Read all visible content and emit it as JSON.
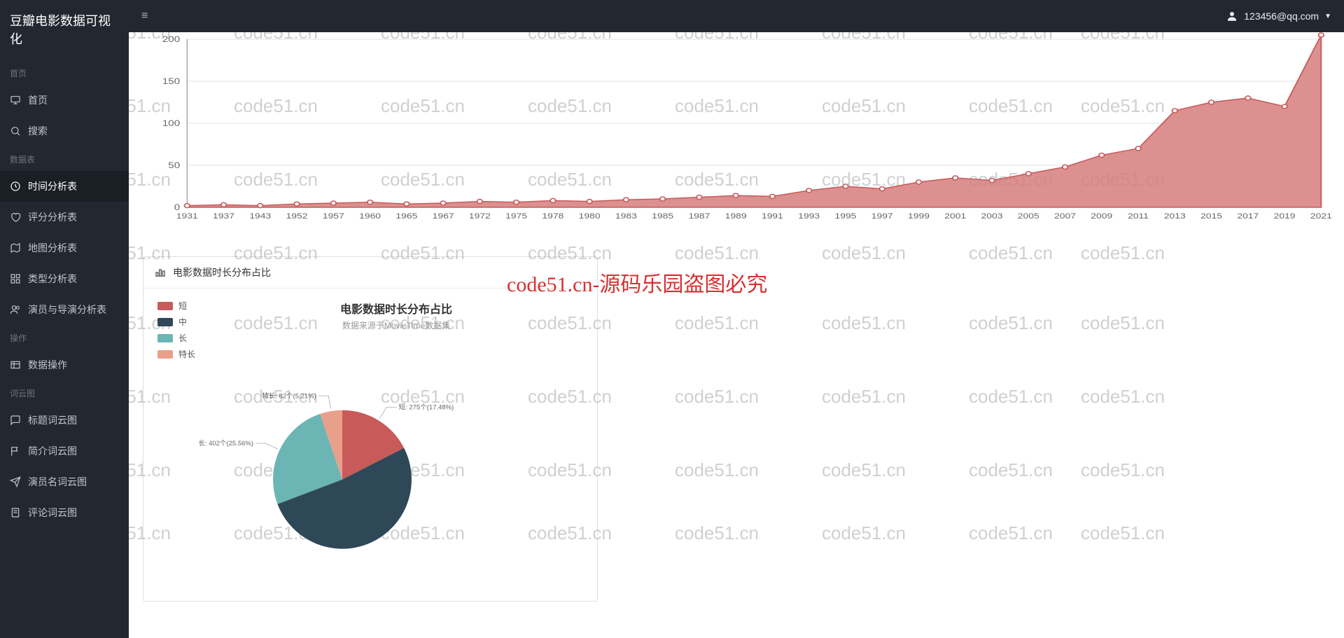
{
  "brand": "豆瓣电影数据可视化",
  "user": {
    "email": "123456@qq.com"
  },
  "sidebar": {
    "sections": [
      {
        "label": "首页",
        "items": [
          {
            "icon": "monitor",
            "label": "首页",
            "active": false
          },
          {
            "icon": "search",
            "label": "搜索",
            "active": false
          }
        ]
      },
      {
        "label": "数据表",
        "items": [
          {
            "icon": "clock",
            "label": "时间分析表",
            "active": true
          },
          {
            "icon": "heart",
            "label": "评分分析表",
            "active": false
          },
          {
            "icon": "map",
            "label": "地图分析表",
            "active": false
          },
          {
            "icon": "grid",
            "label": "类型分析表",
            "active": false
          },
          {
            "icon": "users",
            "label": "演员与导演分析表",
            "active": false
          }
        ]
      },
      {
        "label": "操作",
        "items": [
          {
            "icon": "table",
            "label": "数据操作",
            "active": false
          }
        ]
      },
      {
        "label": "词云图",
        "items": [
          {
            "icon": "comment",
            "label": "标题词云图",
            "active": false
          },
          {
            "icon": "flag",
            "label": "简介词云图",
            "active": false
          },
          {
            "icon": "send",
            "label": "演员名词云图",
            "active": false
          },
          {
            "icon": "doc",
            "label": "评论词云图",
            "active": false
          }
        ]
      }
    ]
  },
  "pieCard": {
    "header": "电影数据时长分布占比",
    "title": "电影数据时长分布占比",
    "subtitle": "数据来源于MovieTime数据集"
  },
  "watermark_text": "code51.cn",
  "watermark_red": "code51.cn-源码乐园盗图必究",
  "chart_data": [
    {
      "type": "area",
      "title": "",
      "ylabel": "",
      "ylim": [
        0,
        200
      ],
      "yticks": [
        0,
        50,
        100,
        150,
        200
      ],
      "categories": [
        "1931",
        "1937",
        "1943",
        "1952",
        "1957",
        "1960",
        "1965",
        "1967",
        "1972",
        "1975",
        "1978",
        "1980",
        "1983",
        "1985",
        "1987",
        "1989",
        "1991",
        "1993",
        "1995",
        "1997",
        "1999",
        "2001",
        "2003",
        "2005",
        "2007",
        "2009",
        "2011",
        "2013",
        "2015",
        "2017",
        "2019",
        "2021"
      ],
      "values": [
        2,
        3,
        2,
        4,
        5,
        6,
        4,
        5,
        7,
        6,
        8,
        7,
        9,
        10,
        12,
        14,
        13,
        20,
        25,
        22,
        30,
        35,
        32,
        40,
        48,
        62,
        70,
        115,
        125,
        130,
        120,
        205
      ]
    },
    {
      "type": "pie",
      "title": "电影数据时长分布占比",
      "subtitle": "数据来源于MovieTime数据集",
      "series": [
        {
          "name": "短",
          "value": 275,
          "pct": 17.48,
          "color": "#c85a5a",
          "label": "短: 275个(17.48%)"
        },
        {
          "name": "中",
          "value": 814,
          "pct": 51.75,
          "color": "#2f4858",
          "label": ""
        },
        {
          "name": "长",
          "value": 402,
          "pct": 25.56,
          "color": "#6bb5b5",
          "label": "长: 402个(25.56%)"
        },
        {
          "name": "特长",
          "value": 82,
          "pct": 5.21,
          "color": "#e8a08a",
          "label": "特长: 82个(5.21%)"
        }
      ]
    }
  ]
}
